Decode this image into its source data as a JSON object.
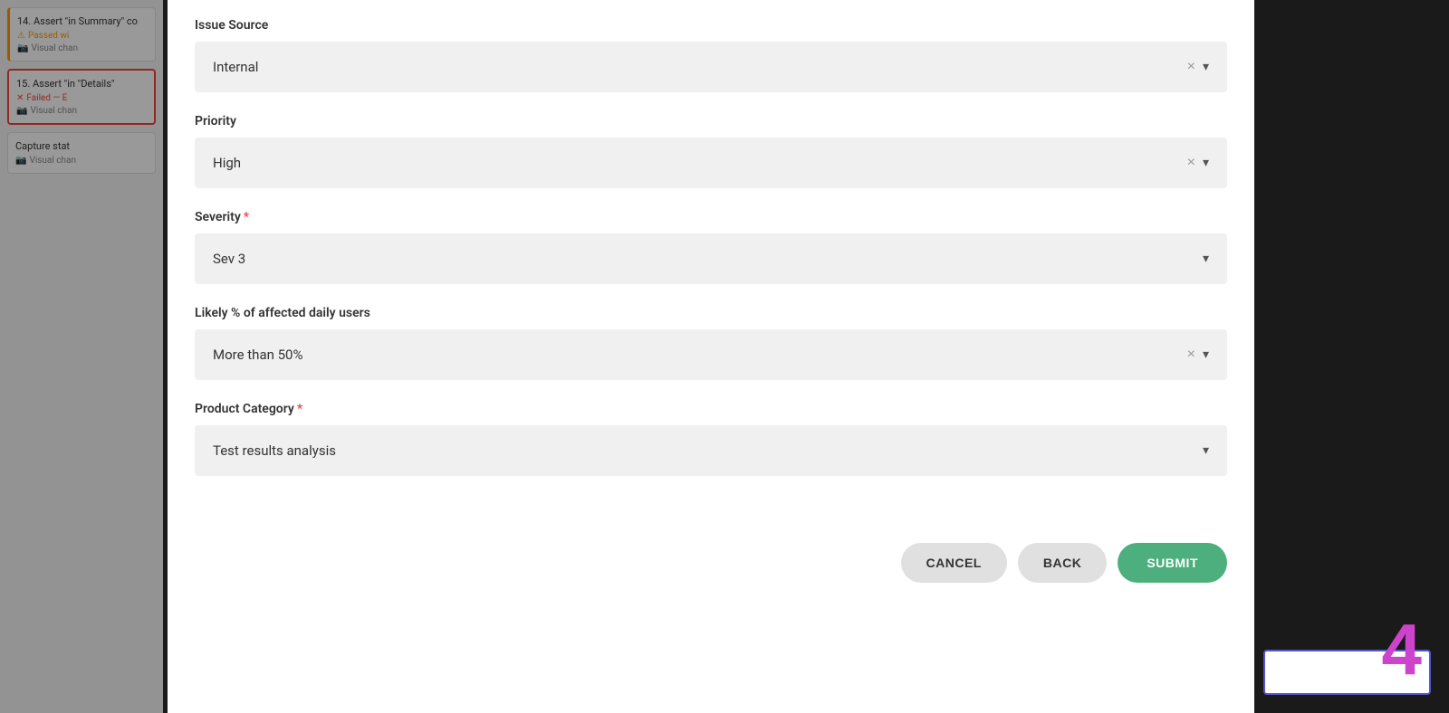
{
  "background": {
    "test_items": [
      {
        "id": "14",
        "title": "14. Assert \"in Summary\" co",
        "status": "passed_warning",
        "badge": "Passed wi",
        "visual_change": "Visual chan"
      },
      {
        "id": "15",
        "title": "15. Assert \"in \"Details\"",
        "status": "failed",
        "badge": "Failed — E",
        "visual_change": "Visual chan"
      },
      {
        "id": "capture",
        "title": "Capture stat",
        "visual_change": "Visual chan"
      }
    ]
  },
  "modal": {
    "fields": {
      "issue_source": {
        "label": "Issue Source",
        "value": "Internal",
        "required": false,
        "has_clear": true
      },
      "priority": {
        "label": "Priority",
        "value": "High",
        "required": false,
        "has_clear": true
      },
      "severity": {
        "label": "Severity",
        "required_marker": "*",
        "value": "Sev 3",
        "required": true,
        "has_clear": false
      },
      "likely_pct": {
        "label": "Likely % of affected daily users",
        "value": "More than 50%",
        "required": false,
        "has_clear": true
      },
      "product_category": {
        "label": "Product Category",
        "required_marker": "*",
        "value": "Test results analysis",
        "required": true,
        "has_clear": false
      }
    },
    "footer": {
      "cancel_label": "CANCEL",
      "back_label": "BACK",
      "submit_label": "SUBMIT"
    }
  },
  "step_number": "4",
  "icons": {
    "warning": "⚠",
    "camera": "📷",
    "x_mark": "✕",
    "chevron_down": "▾",
    "clear": "×"
  }
}
